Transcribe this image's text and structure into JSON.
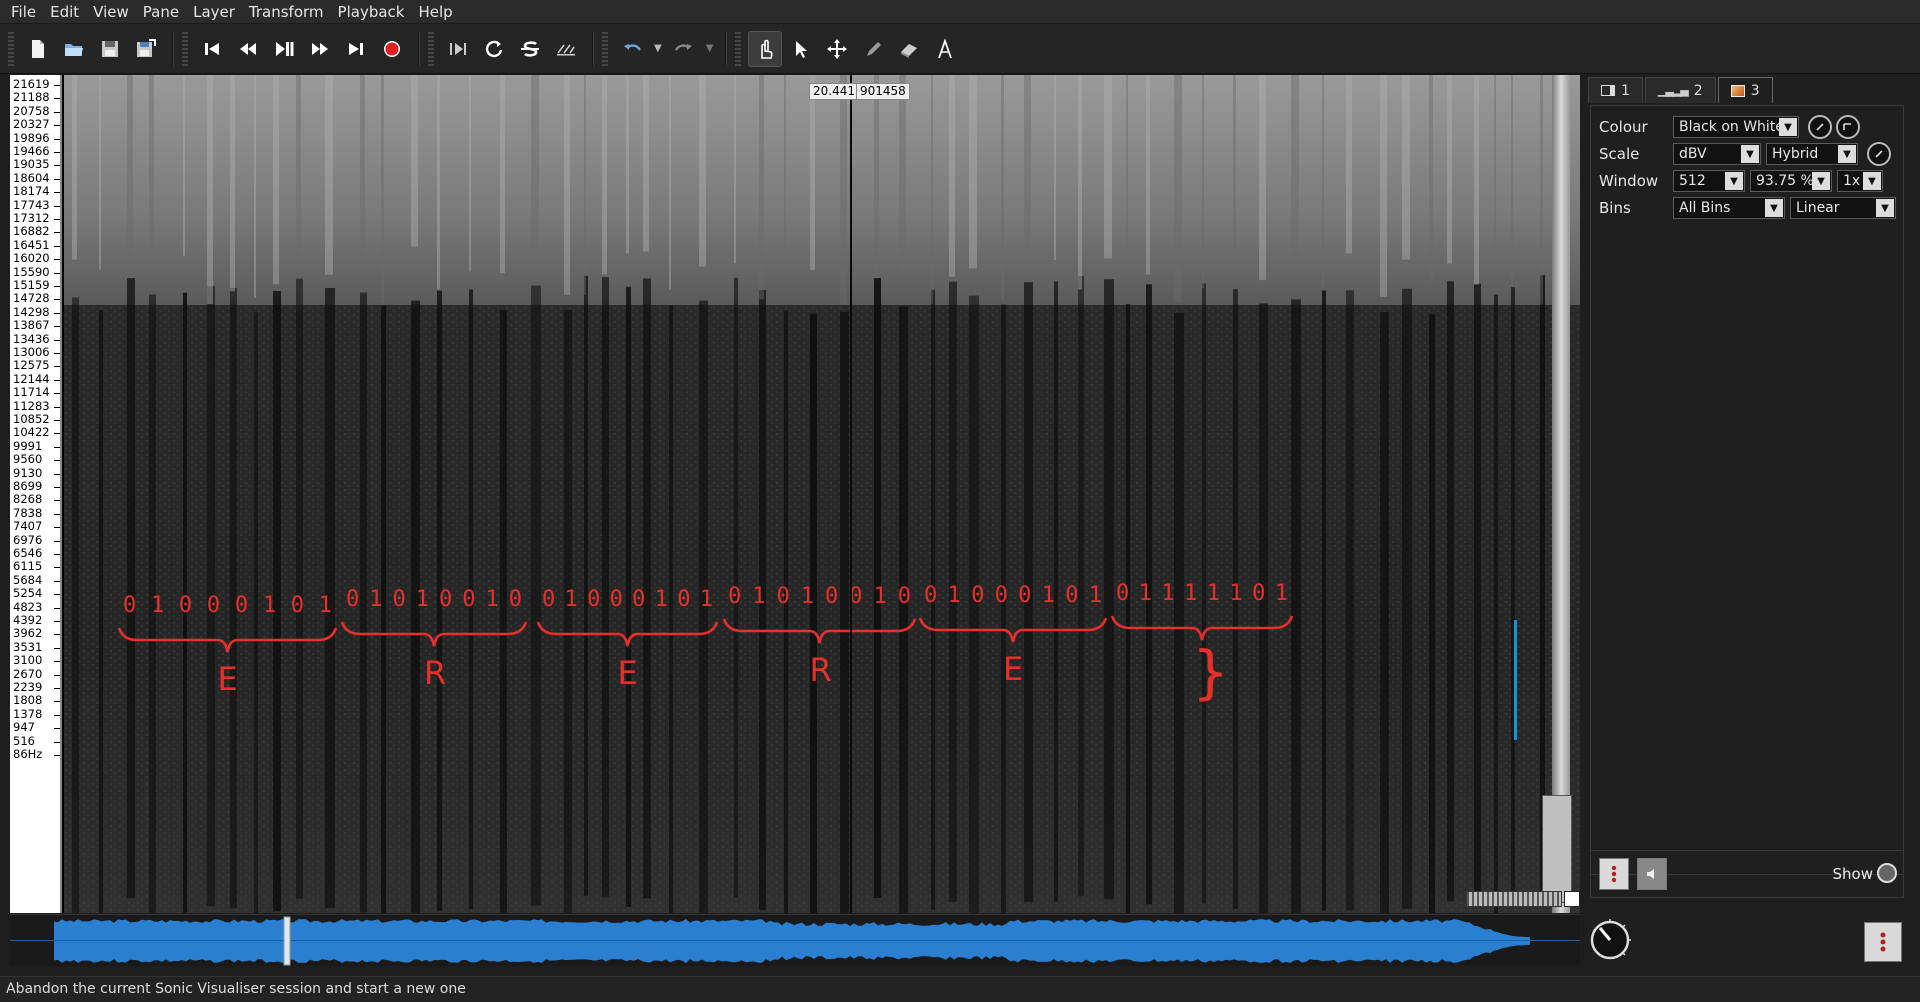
{
  "menu": [
    "File",
    "Edit",
    "View",
    "Pane",
    "Layer",
    "Transform",
    "Playback",
    "Help"
  ],
  "toolbar": {
    "file": [
      "new-session-icon",
      "open-icon",
      "save-icon",
      "save-as-icon"
    ],
    "transport": [
      "rewind-start-icon",
      "rewind-icon",
      "play-pause-icon",
      "fast-forward-icon",
      "fast-forward-end-icon",
      "record-icon"
    ],
    "playmode": [
      "play-selection-icon",
      "loop-icon",
      "solo-icon",
      "follow-playback-icon"
    ],
    "edit": [
      "undo-icon",
      "undo-menu-icon",
      "redo-icon",
      "redo-menu-icon"
    ],
    "tools": [
      "navigate-tool-icon",
      "select-tool-icon",
      "move-tool-icon",
      "draw-tool-icon",
      "erase-tool-icon",
      "measure-tool-icon"
    ],
    "active_tool": "navigate-tool-icon",
    "record_color": "#e02020"
  },
  "view": {
    "frequency_ticks": [
      "21619",
      "21188",
      "20758",
      "20327",
      "19896",
      "19466",
      "19035",
      "18604",
      "18174",
      "17743",
      "17312",
      "16882",
      "16451",
      "16020",
      "15590",
      "15159",
      "14728",
      "14298",
      "13867",
      "13436",
      "13006",
      "12575",
      "12144",
      "11714",
      "11283",
      "10852",
      "10422",
      "9991",
      "9560",
      "9130",
      "8699",
      "8268",
      "7838",
      "7407",
      "6976",
      "6546",
      "6115",
      "5684",
      "5254",
      "4823",
      "4392",
      "3962",
      "3531",
      "3100",
      "2670",
      "2239",
      "1808",
      "1378",
      "947",
      "516",
      "86Hz"
    ],
    "playhead_time": "20.441",
    "playhead_frame": "901458",
    "annotation_color": "#e8302a",
    "annotations": {
      "bits": [
        "01000101",
        "01010010",
        "01000101",
        "01010010",
        "01000101",
        "01111101"
      ],
      "letters": [
        "E",
        "R",
        "E",
        "R",
        "E",
        "}"
      ]
    }
  },
  "panel": {
    "tabs": [
      {
        "icon": "pane-icon",
        "label": "1"
      },
      {
        "icon": "waveform-layer-icon",
        "label": "2"
      },
      {
        "icon": "spectrogram-layer-icon",
        "label": "3"
      }
    ],
    "active_tab": "3",
    "properties": {
      "colour": {
        "label": "Colour",
        "value": "Black on White"
      },
      "scale": {
        "label": "Scale",
        "value": "dBV",
        "mode": "Hybrid"
      },
      "window": {
        "label": "Window",
        "size": "512",
        "overlap": "93.75 %",
        "oversample": "1x"
      },
      "bins": {
        "label": "Bins",
        "display": "All Bins",
        "frequency": "Linear"
      }
    },
    "show_label": "Show"
  },
  "status": "Abandon the current Sonic Visualiser session and start a new one",
  "colors": {
    "waveform": "#2a7fd0",
    "selection_marker": "#1a8fe0"
  }
}
